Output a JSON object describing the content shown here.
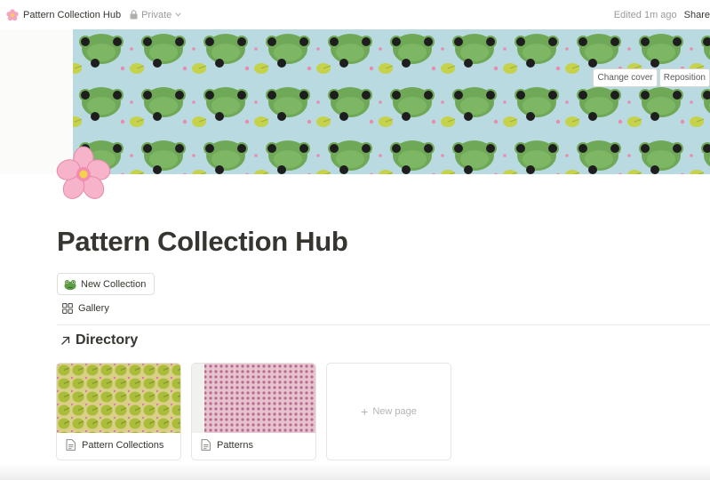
{
  "topbar": {
    "page_title": "Pattern Collection Hub",
    "privacy_label": "Private",
    "edited_label": "Edited 1m ago",
    "share_label": "Share"
  },
  "cover": {
    "change_cover_label": "Change cover",
    "reposition_label": "Reposition"
  },
  "page": {
    "title": "Pattern Collection Hub",
    "new_collection_label": "New Collection",
    "view_tab_label": "Gallery",
    "directory_heading": "Directory"
  },
  "gallery": {
    "cards": [
      {
        "label": "Pattern Collections",
        "icon": "page-icon"
      },
      {
        "label": "Patterns",
        "icon": "page-icon"
      }
    ],
    "new_page_label": "New page"
  },
  "colors": {
    "cover_bg": "#b9dae0",
    "frog_green": "#6fa857",
    "lily_yellow": "#c2d04a",
    "text": "#37352f",
    "muted": "#9b9a97"
  }
}
